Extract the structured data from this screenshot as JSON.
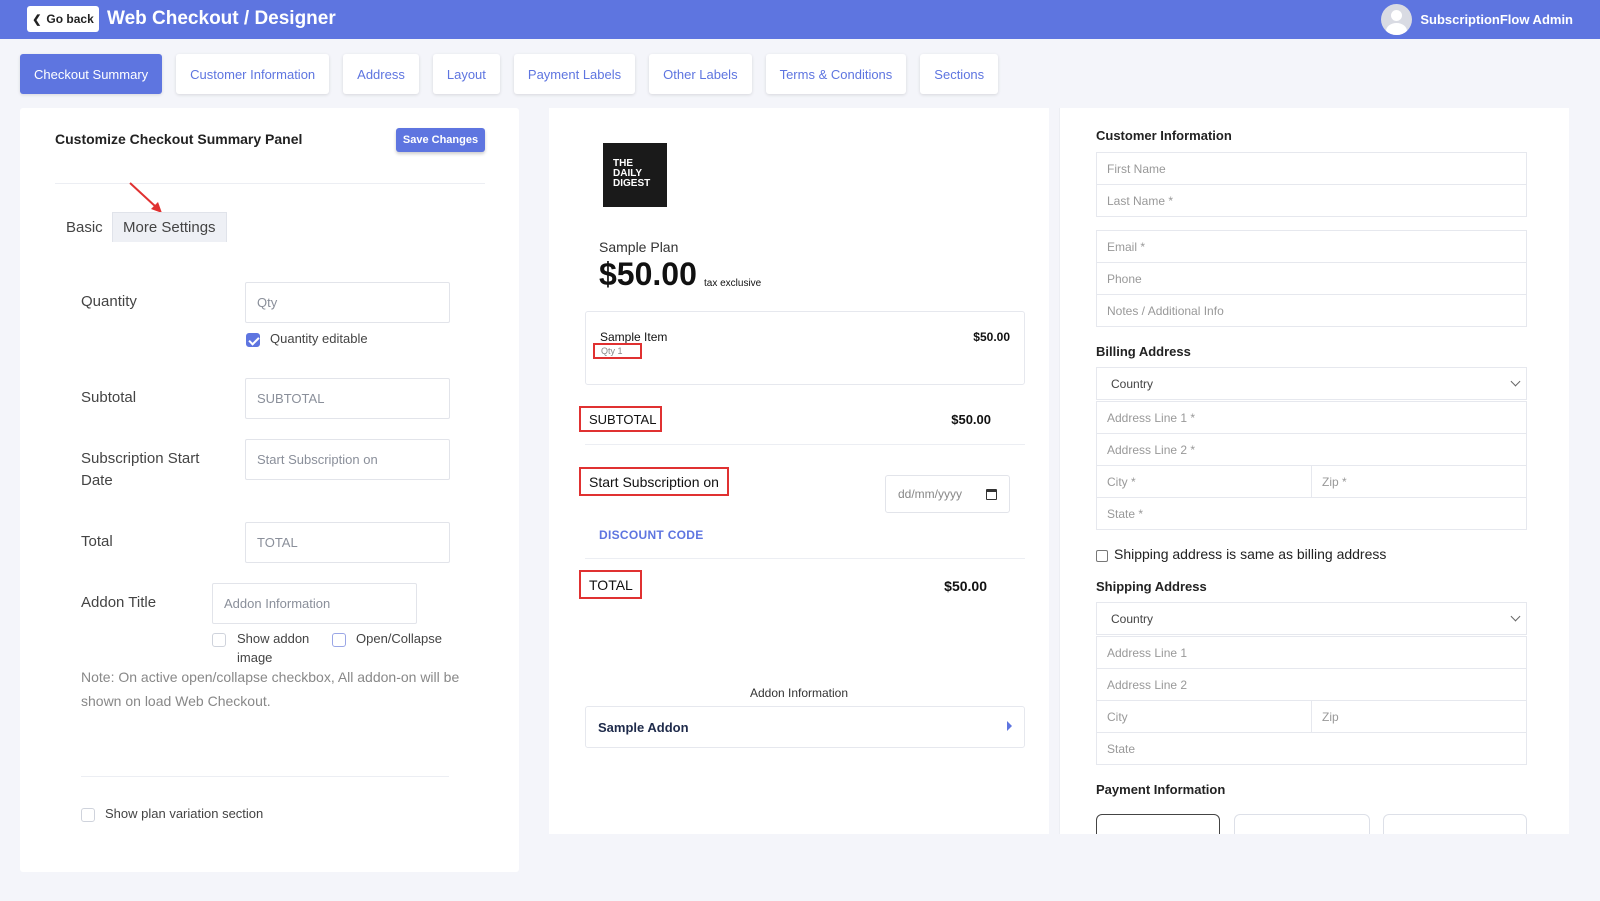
{
  "topbar": {
    "back_label": "Go back",
    "title": "Web Checkout / Designer",
    "user_name": "SubscriptionFlow Admin"
  },
  "tabs": [
    {
      "label": "Checkout Summary",
      "active": true
    },
    {
      "label": "Customer Information"
    },
    {
      "label": "Address"
    },
    {
      "label": "Layout"
    },
    {
      "label": "Payment Labels"
    },
    {
      "label": "Other Labels"
    },
    {
      "label": "Terms & Conditions"
    },
    {
      "label": "Sections"
    }
  ],
  "left_panel": {
    "title": "Customize Checkout Summary Panel",
    "save_label": "Save Changes",
    "subtabs": {
      "basic": "Basic",
      "more": "More Settings"
    },
    "quantity": {
      "label": "Quantity",
      "placeholder": "Qty",
      "editable_label": "Quantity editable",
      "editable_checked": true
    },
    "subtotal": {
      "label": "Subtotal",
      "placeholder": "SUBTOTAL"
    },
    "start_date": {
      "label_line1": "Subscription Start",
      "label_line2": "Date",
      "placeholder": "Start Subscription on"
    },
    "total": {
      "label": "Total",
      "placeholder": "TOTAL"
    },
    "addon": {
      "label": "Addon Title",
      "placeholder": "Addon Information",
      "show_image_line1": "Show addon",
      "show_image_line2": "image",
      "open_collapse": "Open/Collapse"
    },
    "note": "Note: On active open/collapse checkbox, All addon-on will be shown on load Web Checkout.",
    "plan_variation": "Show plan variation section"
  },
  "preview": {
    "logo_lines": [
      "THE",
      "DAILY",
      "DIGEST"
    ],
    "plan_name": "Sample Plan",
    "plan_price": "$50.00",
    "tax_note": "tax exclusive",
    "item": {
      "name": "Sample Item",
      "price": "$50.00",
      "qty_text": "Qty   1"
    },
    "subtotal": {
      "label": "SUBTOTAL",
      "value": "$50.00"
    },
    "start_subscription": {
      "label": "Start Subscription on",
      "date_placeholder": "dd/mm/yyyy"
    },
    "discount_code": "DISCOUNT CODE",
    "total": {
      "label": "TOTAL",
      "value": "$50.00"
    },
    "addon_heading": "Addon Information",
    "addon_name": "Sample Addon"
  },
  "right_panel": {
    "customer_heading": "Customer Information",
    "first_name": "First Name",
    "last_name": "Last Name *",
    "email": "Email *",
    "phone": "Phone",
    "notes": "Notes / Additional Info",
    "billing_heading": "Billing Address",
    "billing": {
      "country": "Country",
      "line1": "Address Line 1 *",
      "line2": "Address Line 2 *",
      "city": "City *",
      "zip": "Zip *",
      "state": "State *"
    },
    "same_address": "Shipping address is same as billing address",
    "shipping_heading": "Shipping Address",
    "shipping": {
      "country": "Country",
      "line1": "Address Line 1",
      "line2": "Address Line 2",
      "city": "City",
      "zip": "Zip",
      "state": "State"
    },
    "payment_heading": "Payment Information"
  },
  "colors": {
    "accent": "#5e75e0",
    "highlight": "#e03131"
  }
}
